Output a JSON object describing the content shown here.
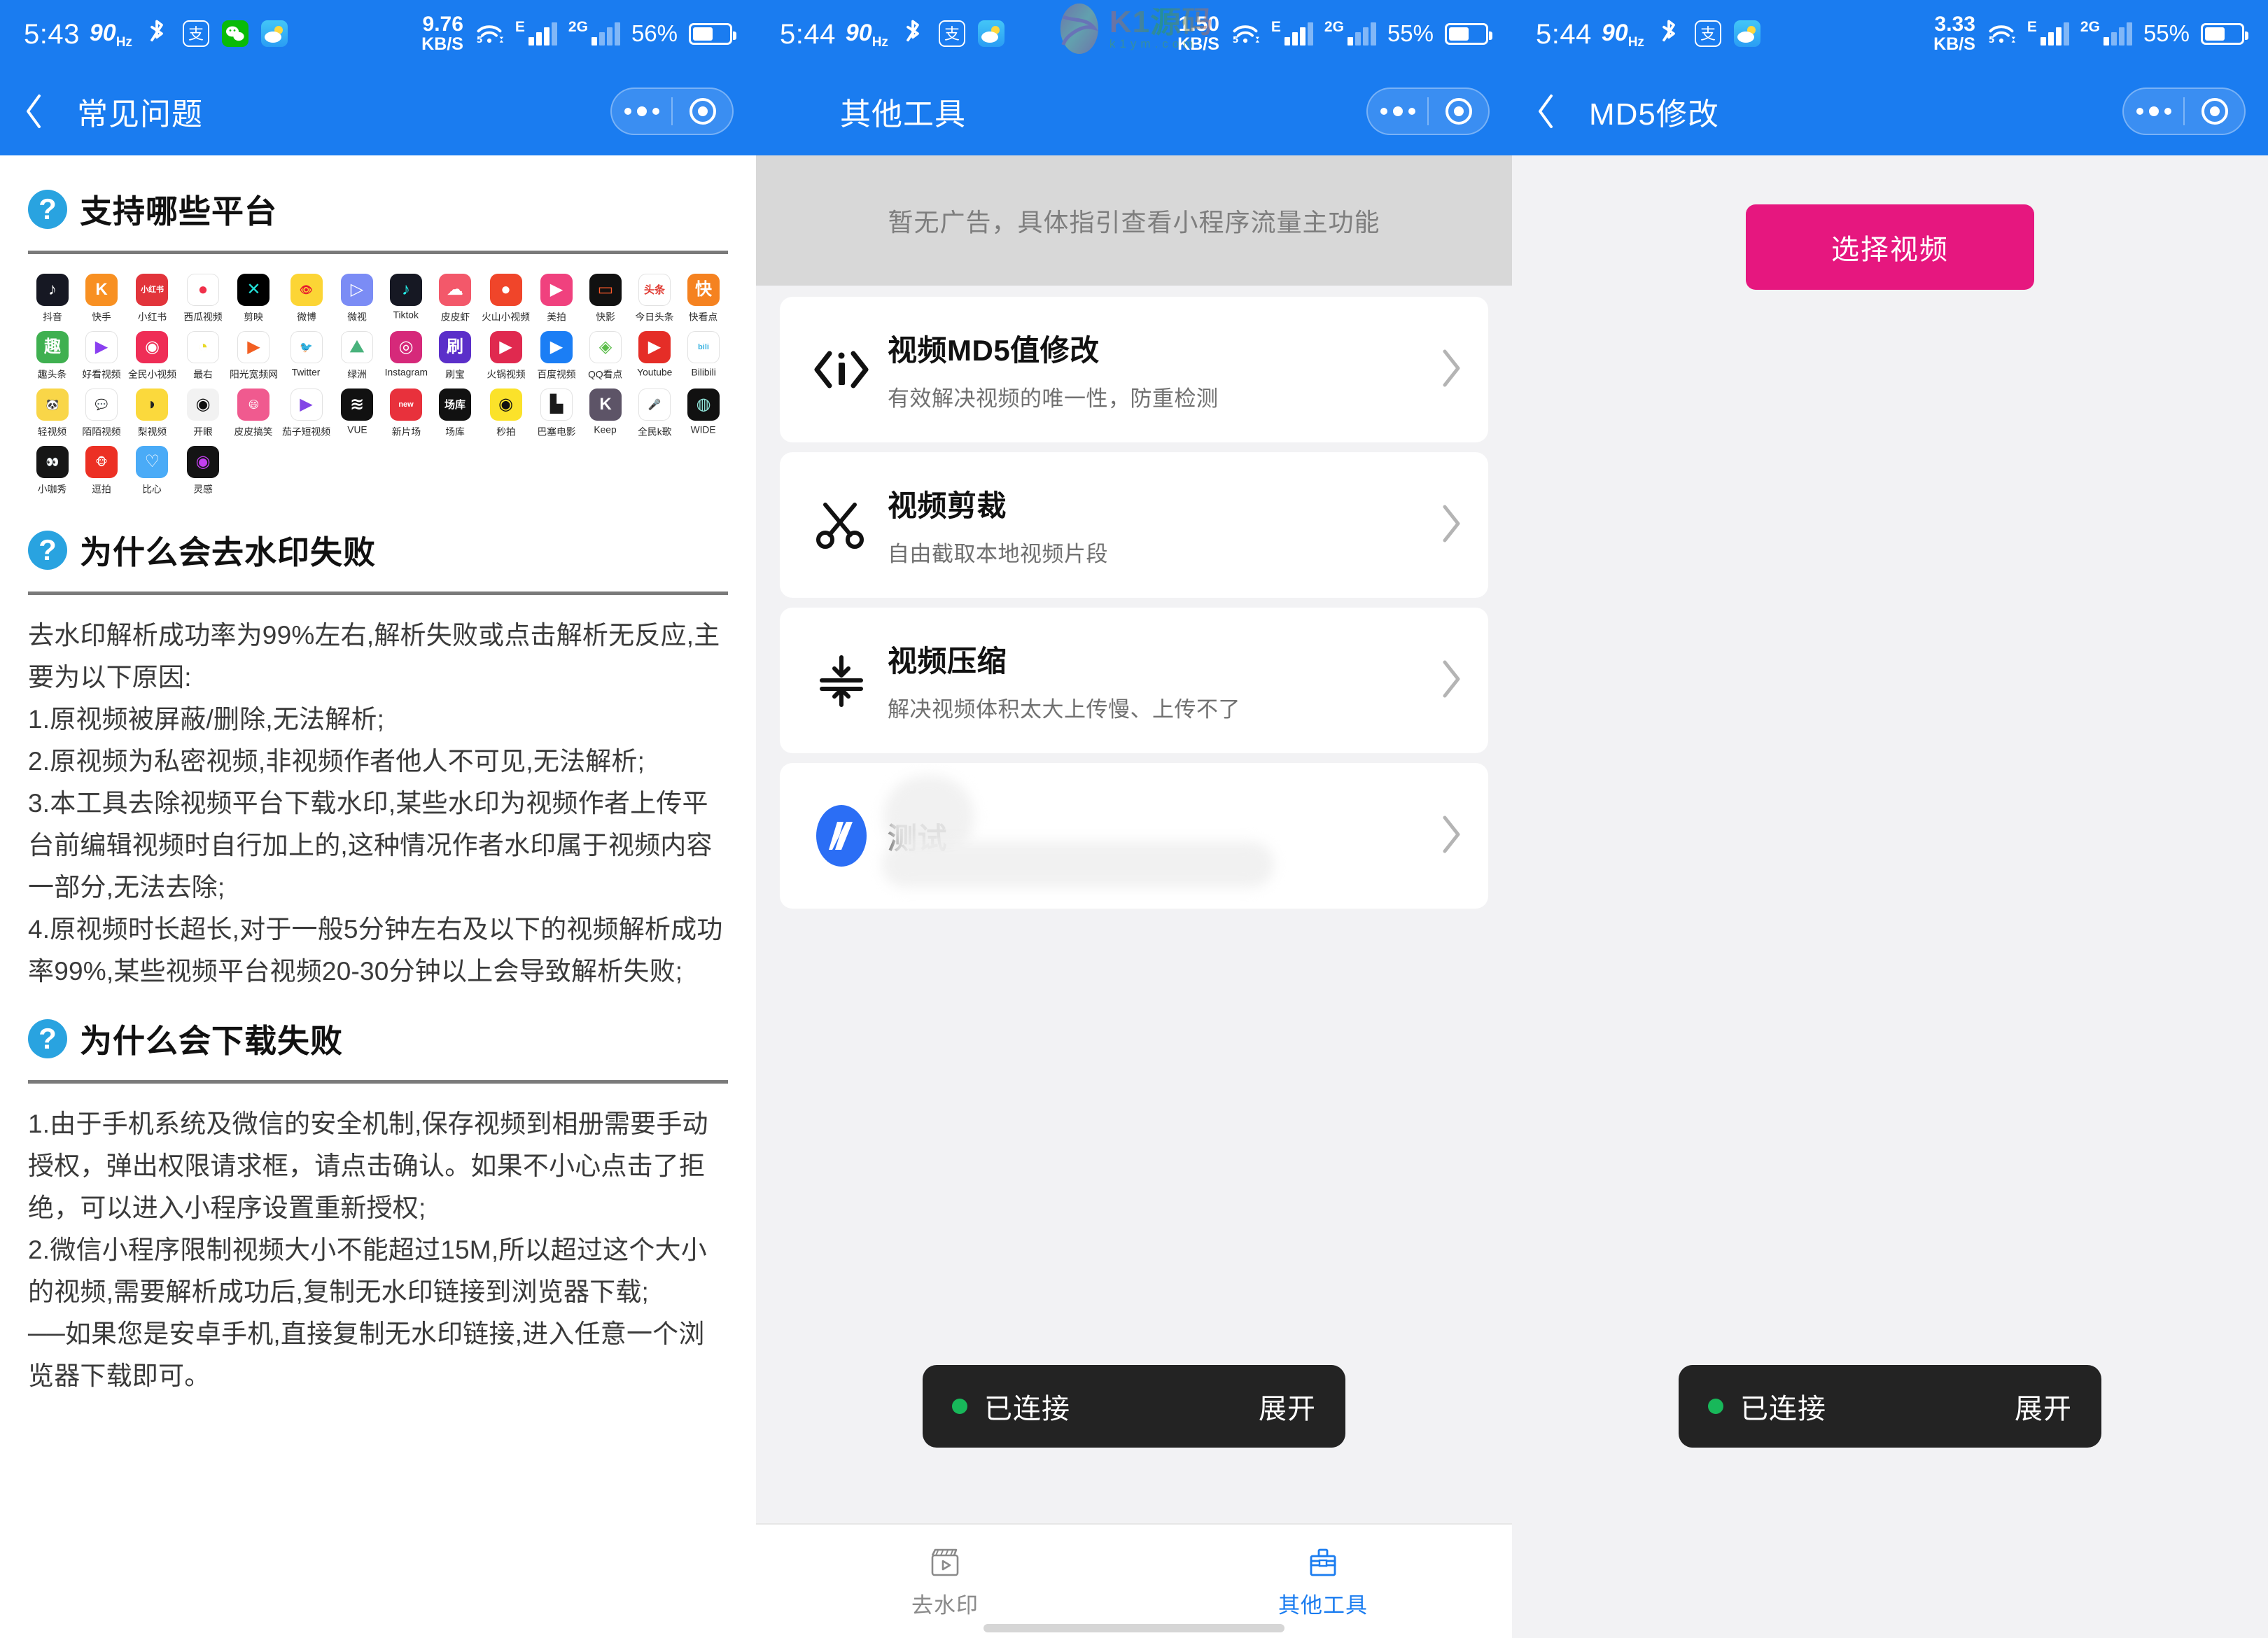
{
  "watermark": {
    "brand": "K1源码",
    "domain": "k1ym.com"
  },
  "panels": [
    {
      "status": {
        "time": "5:43",
        "refresh": "90",
        "refresh_unit": "Hz",
        "icons": [
          "bluetooth-icon",
          "alipay-icon",
          "wechat-icon",
          "weather-icon"
        ],
        "net_speed": "9.76",
        "net_speed_unit": "KB/S",
        "wifi": "5",
        "carrier1": "E",
        "carrier2": "2G",
        "battery_pct": "56%"
      },
      "nav": {
        "back": "‹",
        "title": "常见问题",
        "menu": "more-dots",
        "target": "capsule-target"
      }
    },
    {
      "status": {
        "time": "5:44",
        "refresh": "90",
        "refresh_unit": "Hz",
        "icons": [
          "bluetooth-icon",
          "alipay-icon",
          "weather-icon"
        ],
        "net_speed": "1.50",
        "net_speed_unit": "KB/S",
        "wifi": "5",
        "carrier1": "E",
        "carrier2": "2G",
        "battery_pct": "55%"
      },
      "nav": {
        "back": "",
        "title": "其他工具",
        "menu": "more-dots",
        "target": "capsule-target"
      }
    },
    {
      "status": {
        "time": "5:44",
        "refresh": "90",
        "refresh_unit": "Hz",
        "icons": [
          "bluetooth-icon",
          "alipay-icon",
          "weather-icon"
        ],
        "net_speed": "3.33",
        "net_speed_unit": "KB/S",
        "wifi": "5",
        "carrier1": "E",
        "carrier2": "2G",
        "battery_pct": "55%"
      },
      "nav": {
        "back": "‹",
        "title": "MD5修改",
        "menu": "more-dots",
        "target": "capsule-target"
      }
    }
  ],
  "faq": {
    "sections": [
      {
        "title": "支持哪些平台"
      },
      {
        "title": "为什么会去水印失败",
        "body": "去水印解析成功率为99%左右,解析失败或点击解析无反应,主要为以下原因:\n1.原视频被屏蔽/删除,无法解析;\n2.原视频为私密视频,非视频作者他人不可见,无法解析;\n3.本工具去除视频平台下载水印,某些水印为视频作者上传平台前编辑视频时自行加上的,这种情况作者水印属于视频内容一部分,无法去除;\n4.原视频时长超长,对于一般5分钟左右及以下的视频解析成功率99%,某些视频平台视频20-30分钟以上会导致解析失败;"
      },
      {
        "title": "为什么会下载失败",
        "body": "1.由于手机系统及微信的安全机制,保存视频到相册需要手动授权，弹出权限请求框，请点击确认。如果不小心点击了拒绝，可以进入小程序设置重新授权;\n2.微信小程序限制视频大小不能超过15M,所以超过这个大小的视频,需要解析成功后,复制无水印链接到浏览器下载;\n──如果您是安卓手机,直接复制无水印链接,进入任意一个浏览器下载即可。"
      }
    ],
    "platforms": [
      {
        "label": "抖音",
        "icon": "douyin-icon",
        "bg": "#161823",
        "fg": "#ffffff",
        "glyph": "♪"
      },
      {
        "label": "快手",
        "icon": "kuaishou-icon",
        "bg": "#f89022",
        "fg": "#ffffff",
        "glyph": "K"
      },
      {
        "label": "小红书",
        "icon": "xiaohongshu-icon",
        "bg": "#e2343b",
        "fg": "#ffffff",
        "glyph": "小红书"
      },
      {
        "label": "西瓜视频",
        "icon": "xigua-icon",
        "bg": "#ffffff",
        "fg": "#f0304a",
        "glyph": "●"
      },
      {
        "label": "剪映",
        "icon": "jianying-icon",
        "bg": "#000000",
        "fg": "#22e0d8",
        "glyph": "✕"
      },
      {
        "label": "微博",
        "icon": "weibo-icon",
        "bg": "#fcd535",
        "fg": "#e6162d",
        "glyph": "👁"
      },
      {
        "label": "微视",
        "icon": "weishi-icon",
        "bg": "#7b8cf5",
        "fg": "#ffffff",
        "glyph": "▷"
      },
      {
        "label": "Tiktok",
        "icon": "tiktok-icon",
        "bg": "#161823",
        "fg": "#25f4ee",
        "glyph": "♪"
      },
      {
        "label": "皮皮虾",
        "icon": "pipixia-icon",
        "bg": "#f3586a",
        "fg": "#ffffff",
        "glyph": "☁"
      },
      {
        "label": "火山小视频",
        "icon": "huoshan-icon",
        "bg": "#f0452a",
        "fg": "#ffffff",
        "glyph": "●"
      },
      {
        "label": "美拍",
        "icon": "meipai-icon",
        "bg": "#f0417e",
        "fg": "#ffffff",
        "glyph": "▶"
      },
      {
        "label": "快影",
        "icon": "kuaiying-icon",
        "bg": "#111111",
        "fg": "#ff5a2b",
        "glyph": "▭"
      },
      {
        "label": "今日头条",
        "icon": "toutiao-icon",
        "bg": "#ffffff",
        "fg": "#e03a32",
        "glyph": "头条"
      },
      {
        "label": "快看点",
        "icon": "kuaikandian-icon",
        "bg": "#f58220",
        "fg": "#ffffff",
        "glyph": "快"
      },
      {
        "label": "趣头条",
        "icon": "qutoutiao-icon",
        "bg": "#3fb050",
        "fg": "#ffffff",
        "glyph": "趣"
      },
      {
        "label": "好看视频",
        "icon": "haokan-icon",
        "bg": "#ffffff",
        "fg": "#8a3ff0",
        "glyph": "▶"
      },
      {
        "label": "全民小视频",
        "icon": "quanmin-icon",
        "bg": "#ef2d56",
        "fg": "#ffffff",
        "glyph": "◉"
      },
      {
        "label": "最右",
        "icon": "zuiyou-icon",
        "bg": "#ffffff",
        "fg": "#e8d92a",
        "glyph": "◔"
      },
      {
        "label": "阳光宽频网",
        "icon": "yangguang-icon",
        "bg": "#ffffff",
        "fg": "#f25f22",
        "glyph": "▶"
      },
      {
        "label": "Twitter",
        "icon": "twitter-icon",
        "bg": "#ffffff",
        "fg": "#1da1f2",
        "glyph": "🐦"
      },
      {
        "label": "绿洲",
        "icon": "lvzhou-icon",
        "bg": "#ffffff",
        "fg": "#49b27c",
        "glyph": "⛰"
      },
      {
        "label": "Instagram",
        "icon": "instagram-icon",
        "bg": "#d6297a",
        "fg": "#ffffff",
        "glyph": "◎"
      },
      {
        "label": "刷宝",
        "icon": "shuabao-icon",
        "bg": "#5b2fc9",
        "fg": "#ffffff",
        "glyph": "刷"
      },
      {
        "label": "火锅视频",
        "icon": "huoguo-icon",
        "bg": "#e0294f",
        "fg": "#ffffff",
        "glyph": "▶"
      },
      {
        "label": "百度视频",
        "icon": "baidu-video-icon",
        "bg": "#1b7ef5",
        "fg": "#ffffff",
        "glyph": "▶"
      },
      {
        "label": "QQ看点",
        "icon": "qq-kandian-icon",
        "bg": "#ffffff",
        "fg": "#5bbd4a",
        "glyph": "◈"
      },
      {
        "label": "Youtube",
        "icon": "youtube-icon",
        "bg": "#e52d27",
        "fg": "#ffffff",
        "glyph": "▶"
      },
      {
        "label": "Bilibili",
        "icon": "bilibili-icon",
        "bg": "#ffffff",
        "fg": "#3ab3e0",
        "glyph": "bili"
      },
      {
        "label": "轻视频",
        "icon": "qingshipin-icon",
        "bg": "#f9d648",
        "fg": "#333333",
        "glyph": "🐼"
      },
      {
        "label": "陌陌视频",
        "icon": "momo-icon",
        "bg": "#ffffff",
        "fg": "#9b3cf0",
        "glyph": "💬"
      },
      {
        "label": "梨视频",
        "icon": "lishipin-icon",
        "bg": "#fbd93c",
        "fg": "#222222",
        "glyph": "◗"
      },
      {
        "label": "开眼",
        "icon": "kaiyan-icon",
        "bg": "#f2f2f2",
        "fg": "#111111",
        "glyph": "◉"
      },
      {
        "label": "皮皮搞笑",
        "icon": "pipigaoxiao-icon",
        "bg": "#f05a8f",
        "fg": "#ffffff",
        "glyph": "😄"
      },
      {
        "label": "茄子短视频",
        "icon": "qiezi-icon",
        "bg": "#ffffff",
        "fg": "#8244e6",
        "glyph": "▶"
      },
      {
        "label": "VUE",
        "icon": "vue-icon",
        "bg": "#111111",
        "fg": "#ffffff",
        "glyph": "≋"
      },
      {
        "label": "新片场",
        "icon": "xinpianchang-icon",
        "bg": "#e8313c",
        "fg": "#ffffff",
        "glyph": "new"
      },
      {
        "label": "场库",
        "icon": "changku-icon",
        "bg": "#111111",
        "fg": "#ffffff",
        "glyph": "场库"
      },
      {
        "label": "秒拍",
        "icon": "miaopai-icon",
        "bg": "#fbe22a",
        "fg": "#111111",
        "glyph": "◉"
      },
      {
        "label": "巴塞电影",
        "icon": "basai-icon",
        "bg": "#ffffff",
        "fg": "#1a1a1a",
        "glyph": "▙"
      },
      {
        "label": "Keep",
        "icon": "keep-icon",
        "bg": "#5d5467",
        "fg": "#ffffff",
        "glyph": "K"
      },
      {
        "label": "全民k歌",
        "icon": "quanminkge-icon",
        "bg": "#ffffff",
        "fg": "#ef3f5e",
        "glyph": "🎤"
      },
      {
        "label": "WIDE",
        "icon": "wide-icon",
        "bg": "#111111",
        "fg": "#8fe3d8",
        "glyph": "◍"
      },
      {
        "label": "小咖秀",
        "icon": "xiaokaxiu-icon",
        "bg": "#161616",
        "fg": "#ffffff",
        "glyph": "👀"
      },
      {
        "label": "逗拍",
        "icon": "doupai-icon",
        "bg": "#ec3024",
        "fg": "#ffffff",
        "glyph": "🐵"
      },
      {
        "label": "比心",
        "icon": "bixin-icon",
        "bg": "#4aabf7",
        "fg": "#ffffff",
        "glyph": "♡"
      },
      {
        "label": "灵感",
        "icon": "linggan-icon",
        "bg": "#141414",
        "fg": "#c43ff0",
        "glyph": "◉"
      }
    ]
  },
  "tools": {
    "ad_placeholder": "暂无广告，具体指引查看小程序流量主功能",
    "items": [
      {
        "icon": "code-info-icon",
        "title": "视频MD5值修改",
        "subtitle": "有效解决视频的唯一性，防重检测",
        "chevron": "›",
        "blurred": false
      },
      {
        "icon": "scissors-icon",
        "title": "视频剪裁",
        "subtitle": "自由截取本地视频片段",
        "chevron": "›",
        "blurred": false
      },
      {
        "icon": "compress-icon",
        "title": "视频压缩",
        "subtitle": "解决视频体积太大上传慢、上传不了",
        "chevron": "›",
        "blurred": false
      },
      {
        "icon": "fh-logo-icon",
        "title": "测试",
        "subtitle": "",
        "chevron": "›",
        "blurred": true
      }
    ],
    "tabbar": [
      {
        "icon": "clapperboard-icon",
        "label": "去水印",
        "active": false
      },
      {
        "icon": "toolbox-icon",
        "label": "其他工具",
        "active": true
      }
    ]
  },
  "md5page": {
    "pick_video_button": "选择视频"
  },
  "toast": {
    "status": "已连接",
    "action": "展开",
    "dot_color": "#18b85a"
  },
  "colors": {
    "brand_blue": "#1a7cf0",
    "accent_pink": "#e6177f",
    "toast_bg": "#232323",
    "page_bg": "#f2f2f4"
  }
}
